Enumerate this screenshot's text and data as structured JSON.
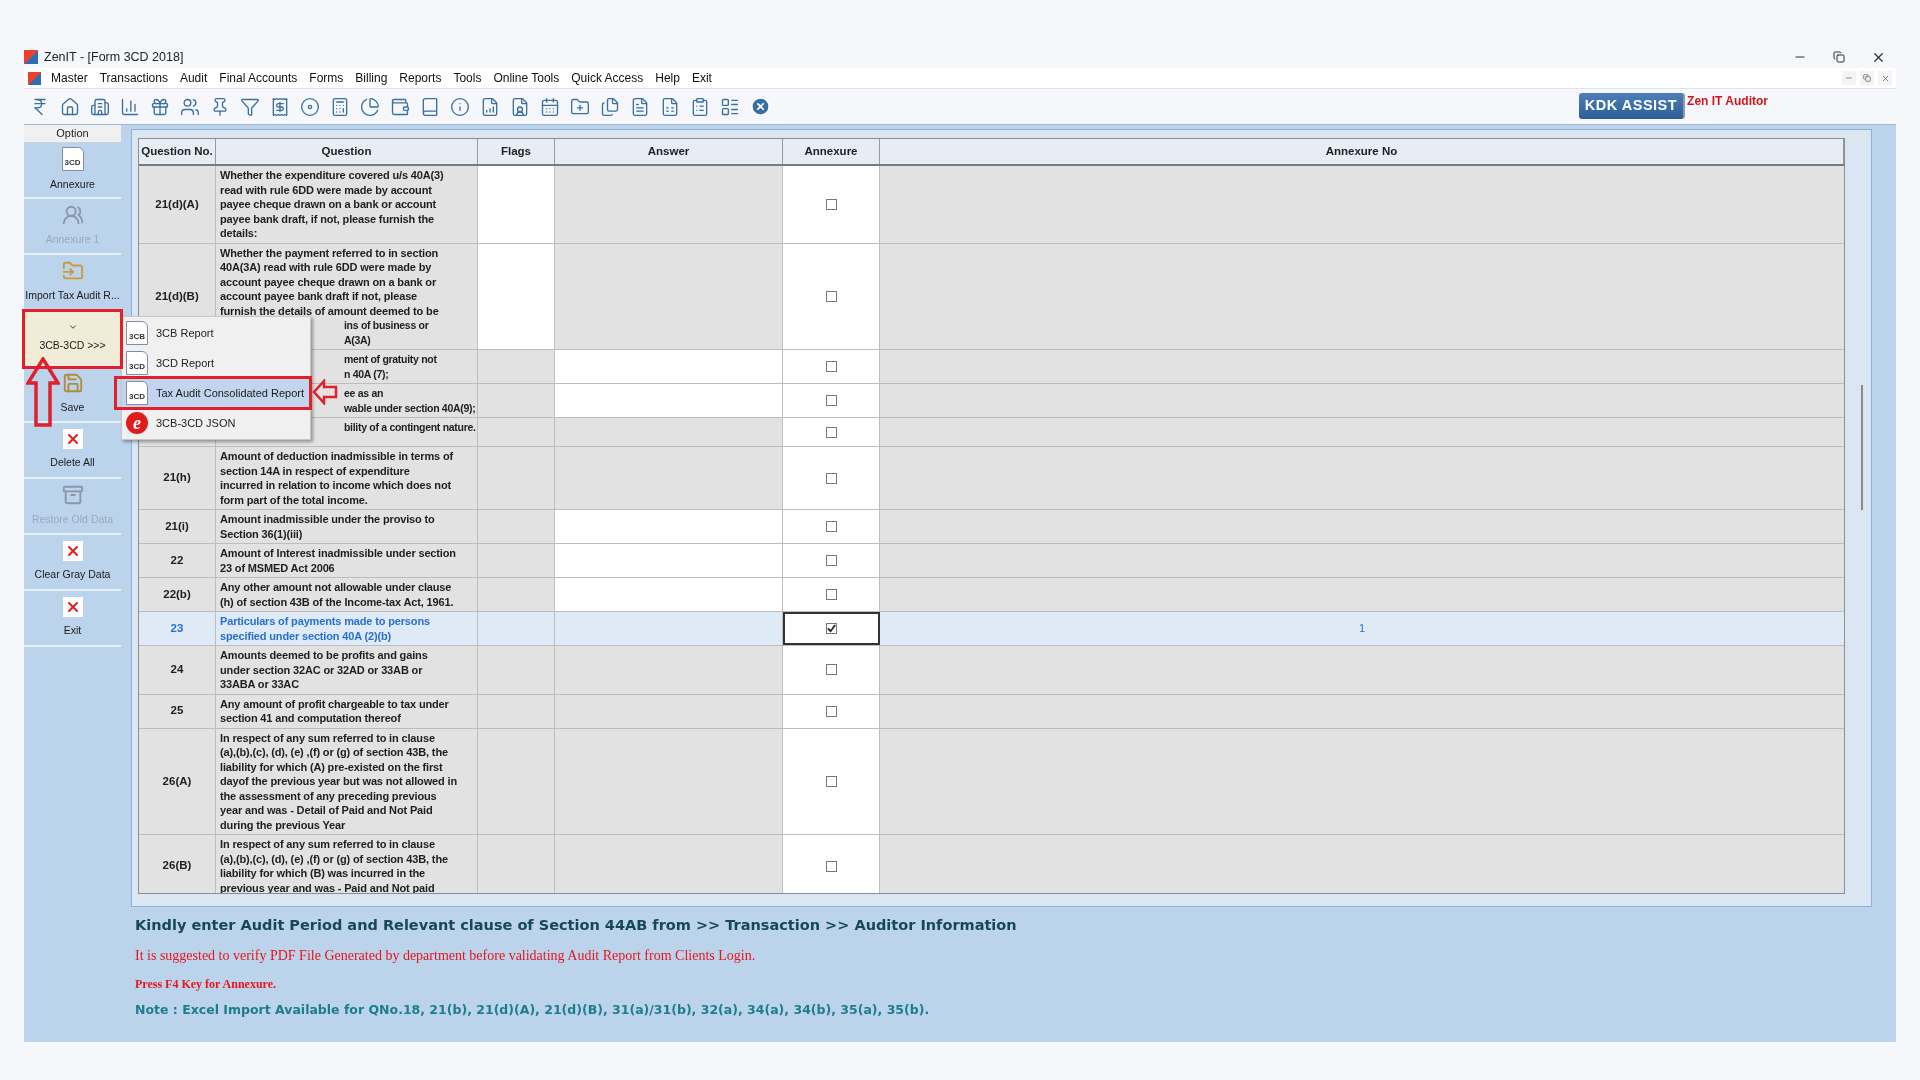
{
  "window": {
    "title": "ZenIT - [Form 3CD 2018]"
  },
  "menu": [
    "Master",
    "Transactions",
    "Audit",
    "Final Accounts",
    "Forms",
    "Billing",
    "Reports",
    "Tools",
    "Online Tools",
    "Quick Access",
    "Help",
    "Exit"
  ],
  "toolbar": {
    "assist_button": "KDK ASSIST",
    "product_label": "Zen IT Auditor"
  },
  "sidebar": {
    "header": "Option",
    "items": [
      {
        "label": "Annexure",
        "icon_text": "3CD",
        "disabled": false,
        "selected": false,
        "marked": false
      },
      {
        "label": "Annexure 1",
        "disabled": true,
        "selected": false,
        "marked": false
      },
      {
        "label": "Import Tax Audit R...",
        "disabled": false,
        "selected": false,
        "marked": false
      },
      {
        "label": "3CB-3CD >>>",
        "disabled": false,
        "selected": true,
        "marked": true
      },
      {
        "label": "Save",
        "disabled": false,
        "selected": false,
        "marked": false
      },
      {
        "label": "Delete All",
        "disabled": false,
        "selected": false,
        "marked": false
      },
      {
        "label": "Restore Old Data",
        "disabled": true,
        "selected": false,
        "marked": false
      },
      {
        "label": "Clear Gray Data",
        "disabled": false,
        "selected": false,
        "marked": false
      },
      {
        "label": "Exit",
        "disabled": false,
        "selected": false,
        "marked": false
      }
    ]
  },
  "popup_menu": [
    {
      "label": "3CB Report",
      "icon_text": "3CB",
      "kind": "doc",
      "selected": false,
      "marked": false
    },
    {
      "label": "3CD Report",
      "icon_text": "3CD",
      "kind": "doc",
      "selected": false,
      "marked": false
    },
    {
      "label": "Tax Audit Consolidated Report",
      "icon_text": "3CD",
      "kind": "doc",
      "selected": true,
      "marked": true
    },
    {
      "label": "3CB-3CD JSON",
      "icon_text": "e",
      "kind": "badge",
      "selected": false,
      "marked": false
    }
  ],
  "table": {
    "columns": [
      "Question No.",
      "Question",
      "Flags",
      "Answer",
      "Annexure",
      "Annexure No"
    ],
    "rows": [
      {
        "no": "21(d)(A)",
        "lines": [
          "Whether the expenditure covered u/s 40A(3)",
          "read with rule 6DD were made by account",
          "payee cheque drawn on a bank or account",
          "payee bank draft, if not, please furnish the",
          "details:"
        ],
        "flags_editable": true,
        "answer_editable": false,
        "checked": false,
        "selected": false
      },
      {
        "no": "21(d)(B)",
        "lines": [
          "Whether the payment referred to in section",
          "40A(3A) read with rule 6DD were made by",
          "account payee cheque drawn on a bank or",
          "account payee bank draft if not, please",
          "furnish the details of amount deemed to be"
        ],
        "covered_lines": [
          "ins of business or",
          "A(3A)"
        ],
        "flags_editable": true,
        "answer_editable": false,
        "checked": false,
        "selected": false
      },
      {
        "covered_lines": [
          "ment of gratuity not",
          "n 40A (7);"
        ],
        "flags_editable": false,
        "answer_editable": true,
        "checked": false,
        "selected": false
      },
      {
        "covered_lines": [
          "ee as an",
          "wable under section 40A(9);"
        ],
        "flags_editable": false,
        "answer_editable": true,
        "checked": false,
        "selected": false
      },
      {
        "covered_lines": [
          "bility of a contingent nature."
        ],
        "flags_editable": false,
        "answer_editable": false,
        "checked": false,
        "selected": false
      },
      {
        "no": "21(h)",
        "lines": [
          "Amount of deduction inadmissible in terms of",
          "section 14A in respect of expenditure",
          "incurred in relation to income which does not",
          "form part of the total income."
        ],
        "flags_editable": false,
        "answer_editable": false,
        "checked": false,
        "selected": false
      },
      {
        "no": "21(i)",
        "lines": [
          "Amount inadmissible under the proviso to",
          "Section 36(1)(iii)"
        ],
        "flags_editable": false,
        "answer_editable": true,
        "checked": false,
        "selected": false
      },
      {
        "no": "22",
        "lines": [
          "Amount of Interest inadmissible under section",
          "23 of MSMED Act 2006"
        ],
        "flags_editable": false,
        "answer_editable": true,
        "checked": false,
        "selected": false
      },
      {
        "no": "22(b)",
        "lines": [
          "Any other amount not allowable under clause",
          "(h) of section 43B of the Income-tax Act, 1961."
        ],
        "flags_editable": false,
        "answer_editable": true,
        "checked": false,
        "selected": false
      },
      {
        "no": "23",
        "lines": [
          "Particulars of payments made to persons",
          "specified under section 40A (2)(b)"
        ],
        "flags_editable": false,
        "answer_editable": false,
        "checked": true,
        "selected": true,
        "annexure_no": "1"
      },
      {
        "no": "24",
        "lines": [
          "Amounts deemed to be profits and gains",
          "under section 32AC or 32AD or 33AB or",
          "33ABA or 33AC"
        ],
        "flags_editable": false,
        "answer_editable": false,
        "checked": false,
        "selected": false
      },
      {
        "no": "25",
        "lines": [
          "Any amount of profit chargeable to tax under",
          "section 41 and computation thereof"
        ],
        "flags_editable": false,
        "answer_editable": false,
        "checked": false,
        "selected": false
      },
      {
        "no": "26(A)",
        "lines": [
          "In respect of any sum referred to in clause",
          "(a),(b),(c), (d), (e) ,(f) or (g) of section 43B, the",
          "liability for which (A) pre-existed on the first",
          "dayof the previous year but was not allowed in",
          "the assessment of any preceding previous",
          "year and was - Detail of Paid and Not Paid",
          "during the previous Year"
        ],
        "flags_editable": false,
        "answer_editable": false,
        "checked": false,
        "selected": false
      },
      {
        "no": "26(B)",
        "lines": [
          "In respect of any sum referred to in clause",
          "(a),(b),(c), (d), (e) ,(f) or (g) of section 43B, the",
          "liability for which (B) was incurred in the",
          "previous year and was - Paid and Not paid"
        ],
        "flags_editable": false,
        "answer_editable": false,
        "checked": false,
        "selected": false
      }
    ]
  },
  "messages": [
    {
      "kind": "heading",
      "text": "Kindly enter Audit Period and Relevant clause of Section 44AB from >> Transaction >> Auditor Information"
    },
    {
      "kind": "warning",
      "text": "It is suggested to verify PDF File Generated by department before validating Audit Report from Clients Login."
    },
    {
      "kind": "hint",
      "text": "Press F4 Key for Annexure."
    },
    {
      "kind": "note",
      "text": "Note : Excel Import Available for QNo.18, 21(b), 21(d)(A), 21(d)(B), 31(a)/31(b), 32(a), 34(a), 34(b), 35(a), 35(b)."
    }
  ]
}
